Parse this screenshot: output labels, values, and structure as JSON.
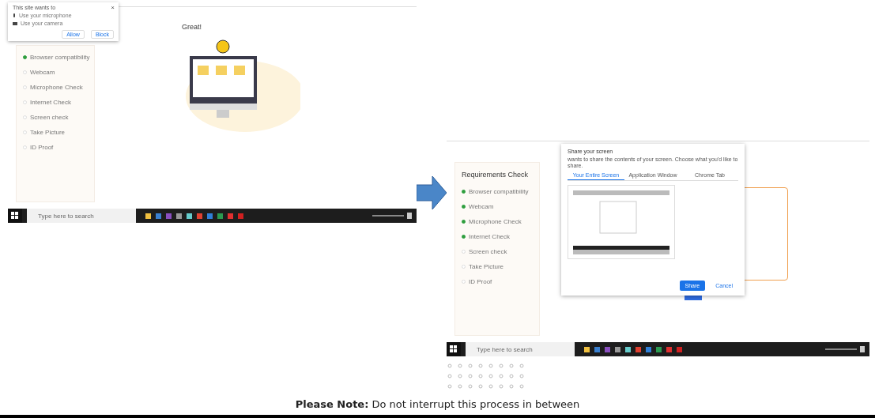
{
  "left_screen": {
    "permission_popup": {
      "close_label": "×",
      "message": "This site wants to",
      "options": [
        {
          "kind": "microphone",
          "label": "Use your microphone"
        },
        {
          "kind": "camera",
          "label": "Use your camera"
        }
      ],
      "buttons": [
        "Allow",
        "Block"
      ]
    },
    "sidebar": {
      "items": [
        {
          "label": "Browser compatibility",
          "done": true
        },
        {
          "label": "Webcam",
          "done": false
        },
        {
          "label": "Microphone Check",
          "done": false
        },
        {
          "label": "Internet Check",
          "done": false
        },
        {
          "label": "Screen check",
          "done": false
        },
        {
          "label": "Take Picture",
          "done": false
        },
        {
          "label": "ID Proof",
          "done": false
        }
      ]
    },
    "heading": "Great!",
    "taskbar": {
      "search_placeholder": "Type here to search"
    }
  },
  "right_screen": {
    "sidebar": {
      "title": "Requirements Check",
      "items": [
        {
          "label": "Browser compatibility",
          "done": true
        },
        {
          "label": "Webcam",
          "done": true
        },
        {
          "label": "Microphone Check",
          "done": true
        },
        {
          "label": "Internet Check",
          "done": true
        },
        {
          "label": "Screen check",
          "done": false
        },
        {
          "label": "Take Picture",
          "done": false
        },
        {
          "label": "ID Proof",
          "done": false
        }
      ]
    },
    "share_dialog": {
      "title": "Share your screen",
      "subtitle": "wants to share the contents of your screen. Choose what you'd like to share.",
      "tabs": [
        {
          "label": "Your Entire Screen",
          "selected": true
        },
        {
          "label": "Application Window",
          "selected": false
        },
        {
          "label": "Chrome Tab",
          "selected": false
        }
      ],
      "buttons": [
        {
          "label": "Share",
          "kind": "primary"
        },
        {
          "label": "Cancel",
          "kind": "text"
        }
      ]
    },
    "taskbar": {
      "search_placeholder": "Type here to search"
    }
  },
  "note": "**Please Note:** Do not interrupt this process in between"
}
